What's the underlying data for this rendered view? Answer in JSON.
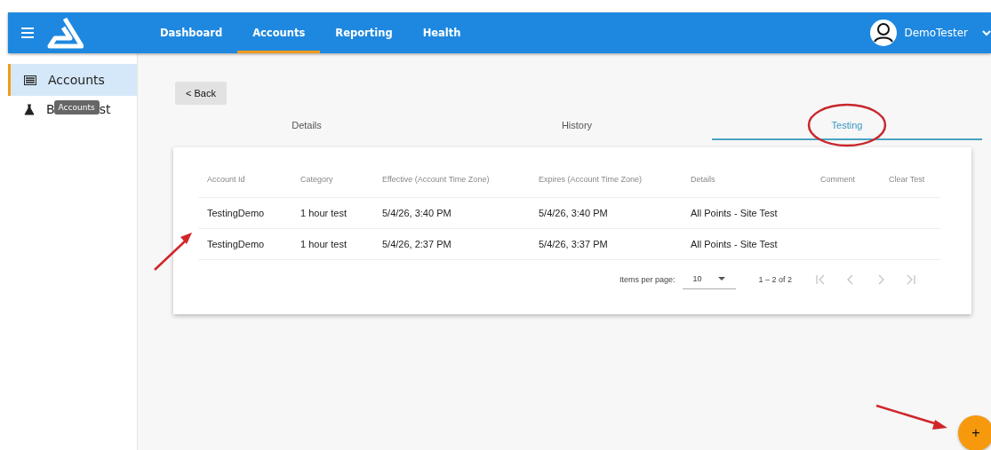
{
  "nav": {
    "tabs": [
      {
        "label": "Dashboard",
        "selected": false
      },
      {
        "label": "Accounts",
        "selected": true
      },
      {
        "label": "Reporting",
        "selected": false
      },
      {
        "label": "Health",
        "selected": false
      }
    ],
    "user": "DemoTester"
  },
  "sidebar": {
    "items": [
      {
        "label": "Accounts",
        "kind": "list",
        "selected": true
      },
      {
        "label_parts": [
          "B",
          "st"
        ],
        "kind": "flask",
        "selected": false,
        "tooltip": "Accounts"
      }
    ]
  },
  "back_button": "< Back",
  "tabs": [
    {
      "label": "Details",
      "selected": false
    },
    {
      "label": "History",
      "selected": false
    },
    {
      "label": "Testing",
      "selected": true
    }
  ],
  "table": {
    "columns": [
      "Account Id",
      "Category",
      "Effective (Account Time Zone)",
      "Expires (Account Time Zone)",
      "Details",
      "Comment",
      "Clear Test"
    ],
    "rows": [
      [
        "TestingDemo",
        "1 hour test",
        "5/4/26, 3:40 PM",
        "5/4/26, 3:40 PM",
        "All Points - Site Test",
        "",
        ""
      ],
      [
        "TestingDemo",
        "1 hour test",
        "5/4/26, 2:37 PM",
        "5/4/26, 3:37 PM",
        "All Points - Site Test",
        "",
        ""
      ]
    ]
  },
  "paginator": {
    "items_per_page_label": "Items per page:",
    "page_size": "10",
    "range": "1 – 2 of 2",
    "first_disabled": true,
    "previous_disabled": true,
    "next_disabled": true,
    "last_disabled": true
  },
  "fab": "+"
}
